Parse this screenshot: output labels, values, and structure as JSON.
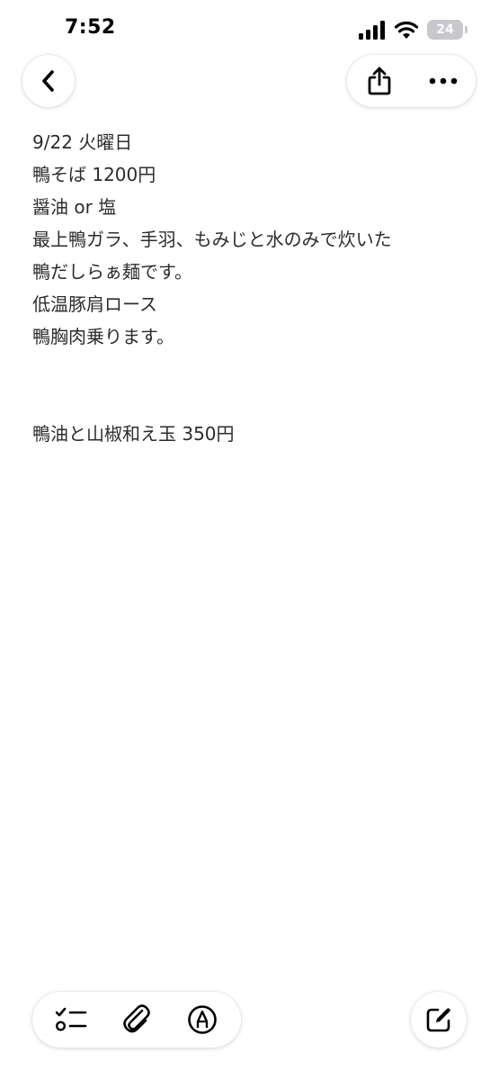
{
  "status_bar": {
    "time": "7:52",
    "battery_level": "24"
  },
  "note": {
    "lines": [
      "9/22 火曜日",
      "鴨そば 1200円",
      "醤油 or 塩",
      "最上鴨ガラ、手羽、もみじと水のみで炊いた",
      "鴨だしらぁ麺です。",
      "低温豚肩ロース",
      "鴨胸肉乗ります。",
      "",
      "",
      "鴨油と山椒和え玉 350円"
    ]
  },
  "icons": {
    "back": "chevron-left-icon",
    "share": "share-icon",
    "more": "ellipsis-icon",
    "checklist": "checklist-icon",
    "attachment": "paperclip-icon",
    "markup": "markup-pen-icon",
    "compose": "compose-icon"
  },
  "colors": {
    "text": "#2c2c2e",
    "icon": "#000000",
    "background": "#ffffff"
  }
}
